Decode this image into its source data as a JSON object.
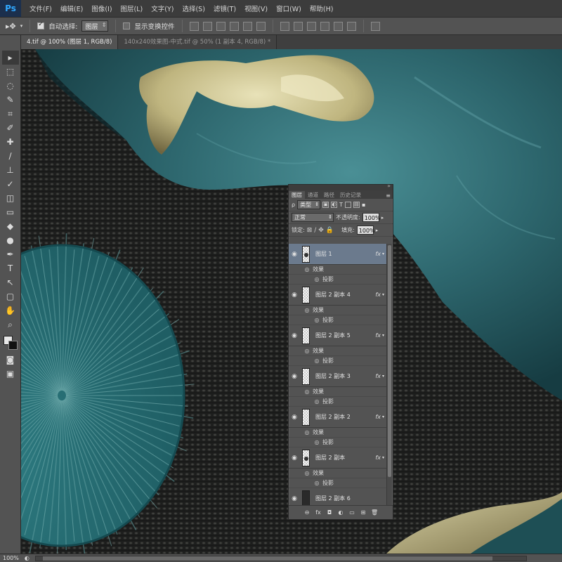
{
  "app": {
    "logo": "Ps"
  },
  "menu": [
    "文件(F)",
    "编辑(E)",
    "图像(I)",
    "图层(L)",
    "文字(Y)",
    "选择(S)",
    "滤镜(T)",
    "视图(V)",
    "窗口(W)",
    "帮助(H)"
  ],
  "options_bar": {
    "move_tool_icon": "move-arrow-icon",
    "auto_select_label": "自动选择:",
    "auto_select_checked": true,
    "auto_select_target": "图层",
    "show_transform_label": "显示变换控件",
    "show_transform_checked": false
  },
  "tabs": [
    {
      "label": "4.tif @ 100% (图层 1, RGB/8)",
      "active": true
    },
    {
      "label": "140x240效果图-中式.tif @ 50% (1 副本 4, RGB/8) *",
      "active": false
    }
  ],
  "tools": [
    "move-icon",
    "marquee-icon",
    "lasso-icon",
    "quick-select-icon",
    "crop-icon",
    "eyedropper-icon",
    "healing-icon",
    "brush-icon",
    "clone-stamp-icon",
    "history-brush-icon",
    "eraser-icon",
    "gradient-icon",
    "blur-icon",
    "dodge-icon",
    "pen-icon",
    "type-icon",
    "path-select-icon",
    "shape-icon",
    "hand-icon",
    "zoom-icon"
  ],
  "tool_glyphs": [
    "▸",
    "⬚",
    "◌",
    "✎",
    "⌗",
    "✐",
    "✚",
    "∕",
    "⊥",
    "✓",
    "◫",
    "▭",
    "◆",
    "●",
    "✒",
    "T",
    "↖",
    "▢",
    "✋",
    "⌕"
  ],
  "colors": {
    "foreground": "#e8e8e8",
    "background": "#111111",
    "selection": "#6b7a8d",
    "teal": "#2c6f74",
    "gold": "#cfc79a"
  },
  "layers_panel": {
    "tabs": [
      "图层",
      "通道",
      "路径",
      "历史记录"
    ],
    "filter_kind": "类型",
    "blend_mode": "正常",
    "opacity_label": "不透明度:",
    "opacity_value": "100%",
    "lock_label": "锁定:",
    "fill_label": "填充:",
    "fill_value": "100%",
    "layers": [
      {
        "name": "图层 1",
        "selected": true,
        "fx": true,
        "effects_label": "效果",
        "effect": "投影"
      },
      {
        "name": "图层 2 副本 4",
        "selected": false,
        "fx": true,
        "effects_label": "效果",
        "effect": "投影"
      },
      {
        "name": "图层 2 副本 5",
        "selected": false,
        "fx": true,
        "effects_label": "效果",
        "effect": "投影"
      },
      {
        "name": "图层 2 副本 3",
        "selected": false,
        "fx": true,
        "effects_label": "效果",
        "effect": "投影"
      },
      {
        "name": "图层 2 副本 2",
        "selected": false,
        "fx": true,
        "effects_label": "效果",
        "effect": "投影"
      },
      {
        "name": "图层 2 副本",
        "selected": false,
        "fx": true,
        "effects_label": "效果",
        "effect": "投影"
      },
      {
        "name": "图层 2 副本 6",
        "selected": false,
        "fx": false
      }
    ],
    "footer_icons": [
      "link-icon",
      "fx-icon",
      "mask-icon",
      "adjustment-icon",
      "group-icon",
      "new-layer-icon",
      "trash-icon"
    ],
    "footer_glyphs": [
      "⊖",
      "fx",
      "◘",
      "◐",
      "▭",
      "⊞",
      "🗑"
    ]
  },
  "status": {
    "zoom": "100%"
  }
}
